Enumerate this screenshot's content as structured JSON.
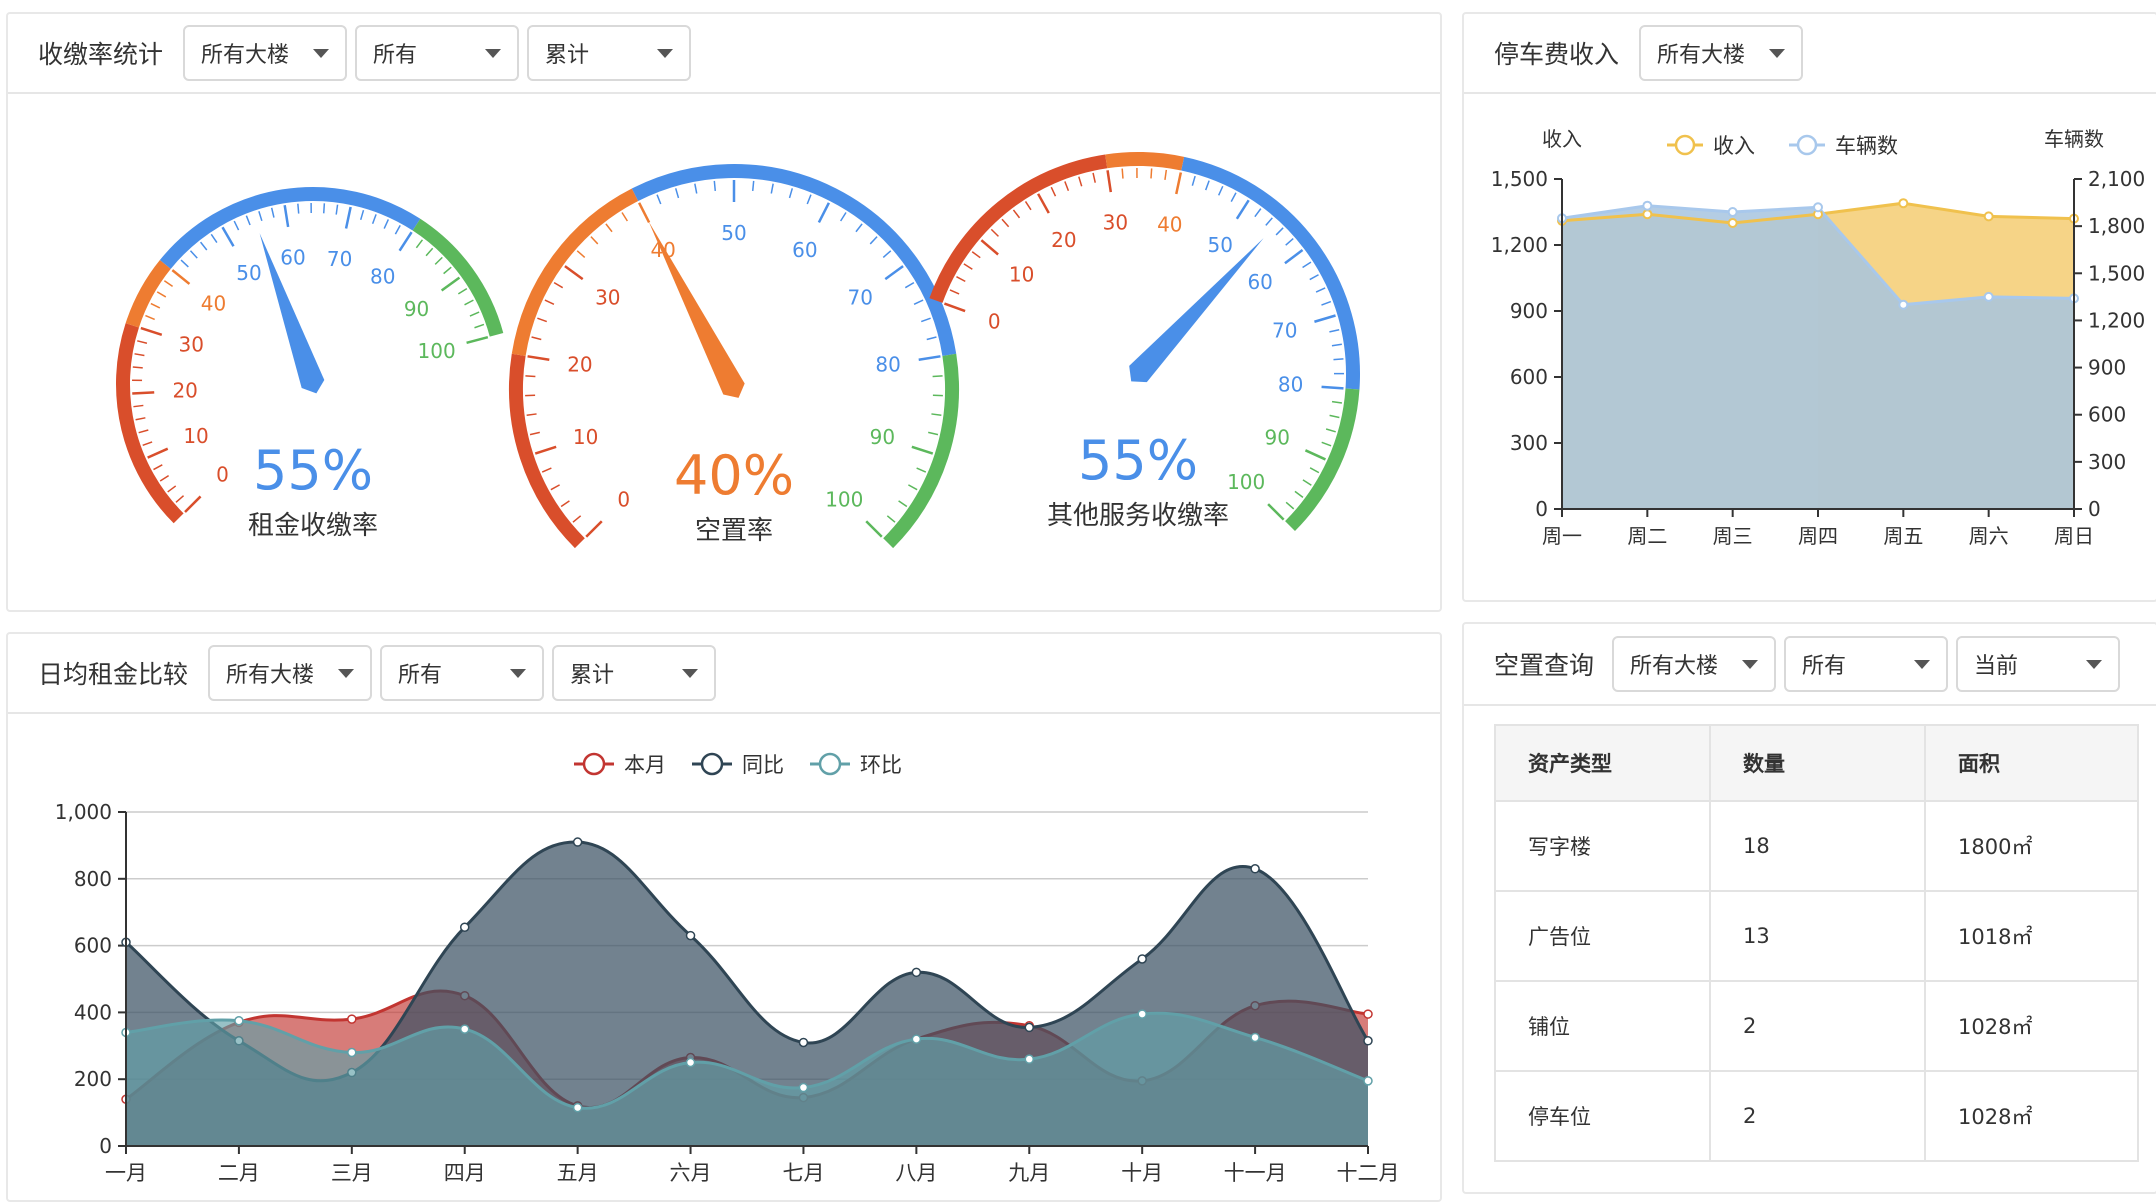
{
  "panels": {
    "collection": {
      "title": "收缴率统计",
      "filters": [
        "所有大楼",
        "所有",
        "累计"
      ]
    },
    "parking": {
      "title": "停车费收入",
      "filters": [
        "所有大楼"
      ]
    },
    "rent": {
      "title": "日均租金比较",
      "filters": [
        "所有大楼",
        "所有",
        "累计"
      ]
    },
    "vacancy": {
      "title": "空置查询",
      "filters": [
        "所有大楼",
        "所有",
        "当前"
      ],
      "columns": [
        "资产类型",
        "数量",
        "面积"
      ],
      "rows": [
        [
          "写字楼",
          "18",
          "1800㎡"
        ],
        [
          "广告位",
          "13",
          "1018㎡"
        ],
        [
          "铺位",
          "2",
          "1028㎡"
        ],
        [
          "停车位",
          "2",
          "1028㎡"
        ]
      ]
    }
  },
  "colors": {
    "red": "#d94e2b",
    "orange": "#ee7c31",
    "blue": "#4a8fe8",
    "green": "#5cb85c",
    "gold": "#f0c14d",
    "lightblue": "#a8c8ec",
    "dark": "#3c5264",
    "crimson": "#c23531",
    "teal": "#5c9aa8"
  },
  "chart_data": [
    {
      "type": "gauge",
      "name": "租金收缴率",
      "value": 55,
      "display": "55%",
      "range": [
        0,
        100
      ],
      "ticks": [
        "0",
        "10",
        "20",
        "30",
        "40",
        "50",
        "60",
        "70",
        "80",
        "90",
        "100"
      ],
      "color": "#4a8fe8"
    },
    {
      "type": "gauge",
      "name": "空置率",
      "value": 40,
      "display": "40%",
      "range": [
        0,
        100
      ],
      "ticks": [
        "0",
        "10",
        "20",
        "30",
        "40",
        "50",
        "60",
        "70",
        "80",
        "90",
        "100"
      ],
      "color": "#ee7c31"
    },
    {
      "type": "gauge",
      "name": "其他服务收缴率",
      "value": 55,
      "display": "55%",
      "range": [
        0,
        100
      ],
      "ticks": [
        "0",
        "10",
        "20",
        "30",
        "40",
        "50",
        "60",
        "70",
        "80",
        "90",
        "100"
      ],
      "color": "#4a8fe8"
    },
    {
      "type": "area",
      "categories": [
        "周一",
        "周二",
        "周三",
        "周四",
        "周五",
        "周六",
        "周日"
      ],
      "series": [
        {
          "name": "收入",
          "axis": "left",
          "values": [
            1310,
            1340,
            1300,
            1340,
            1390,
            1330,
            1320
          ]
        },
        {
          "name": "车辆数",
          "axis": "right",
          "values": [
            1850,
            1930,
            1890,
            1920,
            1300,
            1350,
            1340
          ]
        }
      ],
      "ylabel_left": "收入",
      "ylabel_right": "车辆数",
      "yticks_left": [
        "0",
        "300",
        "600",
        "900",
        "1,200",
        "1,500"
      ],
      "yticks_right": [
        "0",
        "300",
        "600",
        "900",
        "1,200",
        "1,500",
        "1,800",
        "2,100"
      ],
      "ylim_left": [
        0,
        1500
      ],
      "ylim_right": [
        0,
        2100
      ],
      "legend": "top-center"
    },
    {
      "type": "area",
      "categories": [
        "一月",
        "二月",
        "三月",
        "四月",
        "五月",
        "六月",
        "七月",
        "八月",
        "九月",
        "十月",
        "十一月",
        "十二月"
      ],
      "series": [
        {
          "name": "本月",
          "values": [
            140,
            370,
            380,
            450,
            120,
            265,
            145,
            320,
            360,
            195,
            420,
            395
          ]
        },
        {
          "name": "同比",
          "values": [
            610,
            315,
            220,
            655,
            910,
            630,
            310,
            520,
            355,
            560,
            830,
            315
          ]
        },
        {
          "name": "环比",
          "values": [
            340,
            375,
            280,
            350,
            115,
            250,
            175,
            320,
            260,
            395,
            325,
            195
          ]
        }
      ],
      "yticks": [
        "0",
        "200",
        "400",
        "600",
        "800",
        "1,000"
      ],
      "ylim": [
        0,
        1000
      ],
      "grid": true,
      "legend": "top-center"
    }
  ]
}
